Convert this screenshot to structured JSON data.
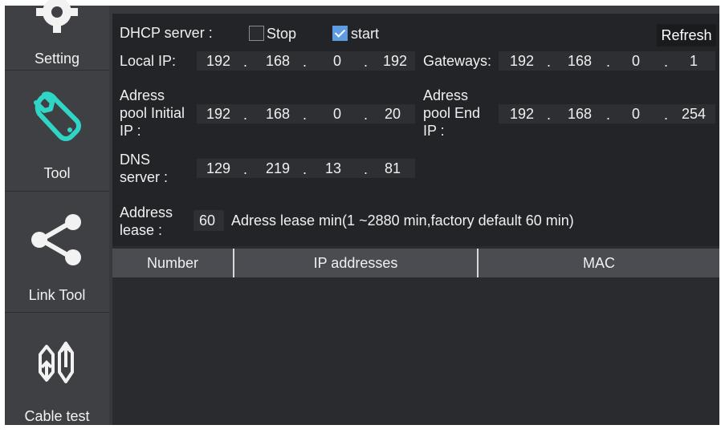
{
  "sidebar": {
    "items": [
      {
        "label": "Setting",
        "icon": "gear-icon"
      },
      {
        "label": "Tool",
        "icon": "wrench-icon",
        "color": "#2fd6c6"
      },
      {
        "label": "Link Tool",
        "icon": "share-icon"
      },
      {
        "label": "Cable test",
        "icon": "cable-test-icon"
      }
    ]
  },
  "dhcp": {
    "server_label": "DHCP server :",
    "stop_label": "Stop",
    "stop_checked": false,
    "start_label": "start",
    "start_checked": true,
    "refresh_label": "Refresh"
  },
  "local_ip": {
    "label": "Local IP:",
    "octets": [
      "192",
      "168",
      "0",
      "192"
    ]
  },
  "gateways": {
    "label": "Gateways:",
    "octets": [
      "192",
      "168",
      "0",
      "1"
    ]
  },
  "pool_initial": {
    "label_lines": [
      "Adress",
      "pool Initial",
      "IP :"
    ],
    "octets": [
      "192",
      "168",
      "0",
      "20"
    ]
  },
  "pool_end": {
    "label_lines": [
      "Adress",
      "pool End",
      "IP :"
    ],
    "octets": [
      "192",
      "168",
      "0",
      "254"
    ]
  },
  "dns": {
    "label_lines": [
      "DNS",
      "server :"
    ],
    "octets": [
      "129",
      "219",
      "13",
      "81"
    ]
  },
  "lease": {
    "label_lines": [
      "Address",
      "lease :"
    ],
    "value": "60",
    "hint": "Adress lease min(1 ~2880 min,factory default 60 min)"
  },
  "table": {
    "columns": [
      "Number",
      "IP addresses",
      "MAC"
    ],
    "rows": []
  },
  "colors": {
    "accent": "#2fd6c6",
    "checkbox": "#5e9be0",
    "panel": "#232427",
    "header": "#4a4c51"
  }
}
